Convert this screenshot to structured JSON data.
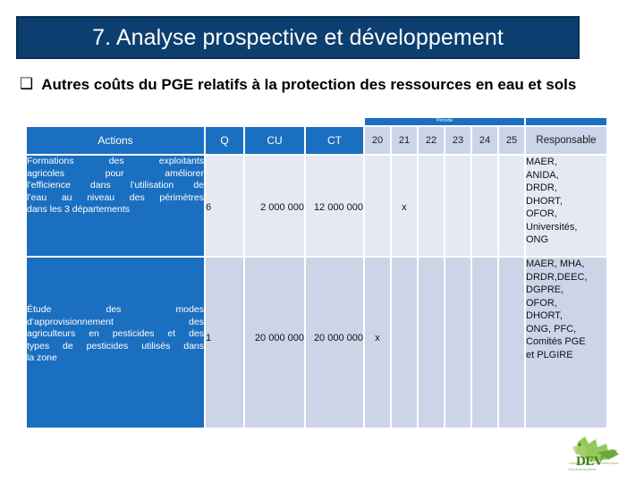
{
  "slide": {
    "title": "7. Analyse prospective et développement",
    "title_bar_color": "#0c3f70",
    "bullet_icon": "❑",
    "bullet_heading": "Autres coûts du PGE relatifs à la protection des ressources en eau et sols"
  },
  "table": {
    "accent_color": "#1b6fc0",
    "header_grey_color": "#ccd4e8",
    "row_light_color": "#e5e9f4",
    "period_group_label": "Période",
    "columns": {
      "actions": "Actions",
      "q": "Q",
      "cu": "CU",
      "ct": "CT",
      "responsable": "Responsable"
    },
    "years": [
      "20",
      "21",
      "22",
      "23",
      "24",
      "25"
    ],
    "rows": [
      {
        "action_lines": [
          "Formations des exploitants",
          "agricoles pour améliorer",
          "l’efficience dans l’utilisation de",
          "l’eau au niveau des périmètres",
          "dans les 3 départements"
        ],
        "action": "Formations des exploitants agricoles pour améliorer l’efficience dans l’utilisation de l’eau au niveau des périmètres dans les 3 départements",
        "q": "6",
        "cu": "2 000 000",
        "ct": "12 000 000",
        "marks": [
          "",
          "x",
          "",
          "",
          "",
          ""
        ],
        "responsable_lines": [
          "MAER,",
          "ANIDA,",
          "DRDR,",
          "DHORT,",
          "OFOR,",
          "Universités,",
          "ONG"
        ],
        "responsable": "MAER, ANIDA, DRDR, DHORT, OFOR, Universités, ONG"
      },
      {
        "action_lines": [
          "Étude des modes",
          "d’approvisionnement des",
          "agriculteurs en pesticides et des",
          "types de pesticides utilisés dans",
          "la zone"
        ],
        "action": "Étude des modes d’approvisionnement des agriculteurs en pesticides et des types de pesticides utilisés dans la zone",
        "q": "1",
        "cu": "20 000 000",
        "ct": "20 000 000",
        "marks": [
          "x",
          "",
          "",
          "",
          "",
          ""
        ],
        "responsable_lines": [
          "MAER, MHA,",
          "DRDR,DEEC,",
          "DGPRE,",
          "OFOR,",
          "DHORT,",
          "ONG, PFC,",
          "Comités PGE",
          "et PLGIRE"
        ],
        "responsable": "MAER, MHA, DRDR,DEEC, DGPRE, OFOR, DHORT, ONG, PFC, Comités PGE et PLGIRE"
      }
    ]
  },
  "logo": {
    "name": "DEV",
    "tagline": "Environnement",
    "color": "#3e7d1e"
  }
}
